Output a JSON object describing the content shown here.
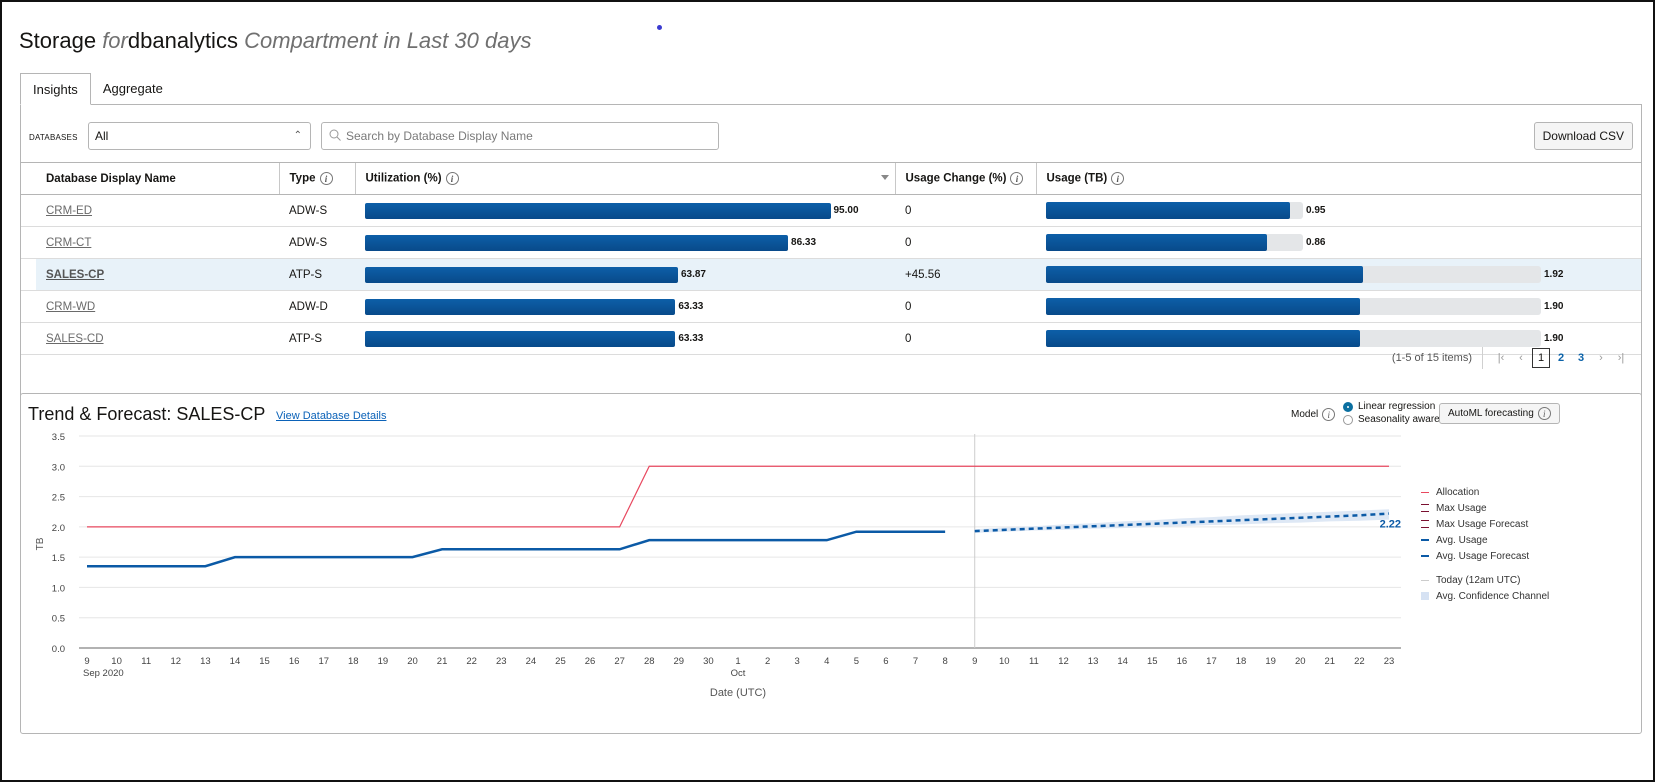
{
  "header": {
    "title_storage": "Storage",
    "title_for": "for",
    "title_compartment": "dbanalytics",
    "title_suffix": "Compartment in Last 30 days"
  },
  "tabs": [
    {
      "label": "Insights",
      "active": true
    },
    {
      "label": "Aggregate",
      "active": false
    }
  ],
  "filters": {
    "databases_label": "DATABASES",
    "databases_value": "All",
    "search_placeholder": "Search by Database Display Name",
    "download_label": "Download CSV"
  },
  "table": {
    "columns": [
      "Database Display Name",
      "Type",
      "Utilization (%)",
      "Usage Change (%)",
      "Usage (TB)"
    ],
    "rows": [
      {
        "name": "CRM-ED",
        "type": "ADW-S",
        "utilization": 95.0,
        "utilization_label": "95.00",
        "usage_change": "0",
        "usage_tb": 0.95,
        "usage_label": "0.95",
        "allocated_tb": 1.0,
        "selected": false
      },
      {
        "name": "CRM-CT",
        "type": "ADW-S",
        "utilization": 86.33,
        "utilization_label": "86.33",
        "usage_change": "0",
        "usage_tb": 0.86,
        "usage_label": "0.86",
        "allocated_tb": 1.0,
        "selected": false
      },
      {
        "name": "SALES-CP",
        "type": "ATP-S",
        "utilization": 63.87,
        "utilization_label": "63.87",
        "usage_change": "+45.56",
        "usage_tb": 1.92,
        "usage_label": "1.92",
        "allocated_tb": 3.0,
        "selected": true
      },
      {
        "name": "CRM-WD",
        "type": "ADW-D",
        "utilization": 63.33,
        "utilization_label": "63.33",
        "usage_change": "0",
        "usage_tb": 1.9,
        "usage_label": "1.90",
        "allocated_tb": 3.0,
        "selected": false
      },
      {
        "name": "SALES-CD",
        "type": "ATP-S",
        "utilization": 63.33,
        "utilization_label": "63.33",
        "usage_change": "0",
        "usage_tb": 1.9,
        "usage_label": "1.90",
        "allocated_tb": 3.0,
        "selected": false
      }
    ]
  },
  "pagination": {
    "summary": "(1-5 of 15 items)",
    "pages": [
      "1",
      "2",
      "3"
    ],
    "current": "1"
  },
  "trend": {
    "title": "Trend & Forecast: SALES-CP",
    "view_link": "View Database Details",
    "model_label": "Model",
    "models": [
      {
        "label": "Linear regression",
        "selected": true
      },
      {
        "label": "Seasonality aware",
        "selected": false
      }
    ],
    "automl_label": "AutoML forecasting"
  },
  "colors": {
    "allocation": "#e8485f",
    "avg_usage": "#0b5aa6",
    "today_line": "#cccccc",
    "confidence": "#d6e2f3",
    "bar": "#0b5aa6",
    "link": "#0b62b8"
  },
  "chart_data": {
    "type": "line",
    "title": "Trend & Forecast: SALES-CP",
    "xlabel": "Date (UTC)",
    "ylabel": "TB",
    "ylim": [
      0,
      3.5
    ],
    "yticks": [
      "0.0",
      "0.5",
      "1.0",
      "1.5",
      "2.0",
      "2.5",
      "3.0",
      "3.5"
    ],
    "x": [
      "9",
      "10",
      "11",
      "12",
      "13",
      "14",
      "15",
      "16",
      "17",
      "18",
      "19",
      "20",
      "21",
      "22",
      "23",
      "24",
      "25",
      "26",
      "27",
      "28",
      "29",
      "30",
      "1",
      "2",
      "3",
      "4",
      "5",
      "6",
      "7",
      "8",
      "9",
      "10",
      "11",
      "12",
      "13",
      "14",
      "15",
      "16",
      "17",
      "18",
      "19",
      "20",
      "21",
      "22",
      "23"
    ],
    "x_sublabels": {
      "0": "Sep 2020",
      "22": "Oct"
    },
    "today_index": 30,
    "series": [
      {
        "name": "Allocation",
        "style": "solid",
        "start_index": 0,
        "values": [
          2,
          2,
          2,
          2,
          2,
          2,
          2,
          2,
          2,
          2,
          2,
          2,
          2,
          2,
          2,
          2,
          2,
          2,
          2,
          3,
          3,
          3,
          3,
          3,
          3,
          3,
          3,
          3,
          3,
          3,
          3,
          3,
          3,
          3,
          3,
          3,
          3,
          3,
          3,
          3,
          3,
          3,
          3,
          3,
          3
        ]
      },
      {
        "name": "Avg. Usage",
        "style": "solid",
        "start_index": 0,
        "values": [
          1.35,
          1.35,
          1.35,
          1.35,
          1.35,
          1.5,
          1.5,
          1.5,
          1.5,
          1.5,
          1.5,
          1.5,
          1.63,
          1.63,
          1.63,
          1.63,
          1.63,
          1.63,
          1.63,
          1.78,
          1.78,
          1.78,
          1.78,
          1.78,
          1.78,
          1.78,
          1.92,
          1.92,
          1.92,
          1.92
        ]
      },
      {
        "name": "Avg. Usage Forecast",
        "style": "dashed",
        "start_index": 30,
        "values": [
          1.93,
          1.95,
          1.97,
          1.99,
          2.01,
          2.03,
          2.05,
          2.07,
          2.09,
          2.11,
          2.13,
          2.15,
          2.17,
          2.19,
          2.22
        ],
        "end_label": "2.22"
      },
      {
        "name": "Avg. Confidence Channel",
        "style": "band",
        "start_index": 30,
        "lower": [
          1.9,
          1.92,
          1.94,
          1.95,
          1.97,
          1.98,
          2.0,
          2.01,
          2.03,
          2.04,
          2.06,
          2.07,
          2.09,
          2.1,
          2.12
        ],
        "upper": [
          1.96,
          1.99,
          2.01,
          2.04,
          2.06,
          2.09,
          2.11,
          2.14,
          2.16,
          2.19,
          2.21,
          2.23,
          2.25,
          2.27,
          2.29
        ]
      }
    ],
    "legend": [
      "Allocation",
      "Max Usage",
      "Max Usage Forecast",
      "Avg. Usage",
      "Avg. Usage Forecast",
      "Today (12am UTC)",
      "Avg. Confidence Channel"
    ],
    "legend_position": "right",
    "grid": true
  }
}
